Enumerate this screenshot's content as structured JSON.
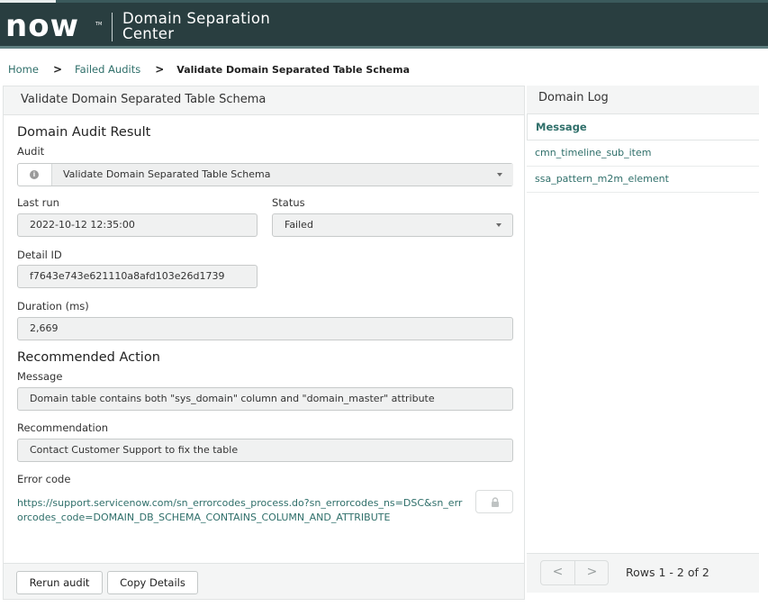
{
  "header": {
    "logo_text": "now",
    "logo_tm": "TM",
    "app_title_line1": "Domain Separation",
    "app_title_line2": "Center"
  },
  "breadcrumb": {
    "home": "Home",
    "failed_audits": "Failed Audits",
    "current": "Validate Domain Separated Table Schema",
    "separator": ">"
  },
  "panel": {
    "title": "Validate Domain Separated Table Schema"
  },
  "audit_result": {
    "section_title": "Domain Audit Result",
    "audit_label": "Audit",
    "audit_value": "Validate Domain Separated Table Schema",
    "last_run_label": "Last run",
    "last_run_value": "2022-10-12 12:35:00",
    "status_label": "Status",
    "status_value": "Failed",
    "detail_id_label": "Detail ID",
    "detail_id_value": "f7643e743e621110a8afd103e26d1739",
    "duration_label": "Duration (ms)",
    "duration_value": "2,669"
  },
  "recommended_action": {
    "section_title": "Recommended Action",
    "message_label": "Message",
    "message_value": "Domain table contains both \"sys_domain\" column and \"domain_master\" attribute",
    "recommendation_label": "Recommendation",
    "recommendation_value": "Contact Customer Support to fix the table",
    "error_code_label": "Error code",
    "error_code_link": "https://support.servicenow.com/sn_errorcodes_process.do?sn_errorcodes_ns=DSC&sn_errorcodes_code=DOMAIN_DB_SCHEMA_CONTAINS_COLUMN_AND_ATTRIBUTE"
  },
  "buttons": {
    "rerun": "Rerun audit",
    "copy": "Copy Details"
  },
  "domain_log": {
    "title": "Domain Log",
    "column_header": "Message",
    "rows": [
      "cmn_timeline_sub_item",
      "ssa_pattern_m2m_element"
    ],
    "pager_prev": "<",
    "pager_next": ">",
    "rows_label": "Rows 1 - 2 of 2"
  },
  "icons": {
    "info": "info-icon",
    "lock": "lock-icon",
    "caret": "chevron-down-icon"
  },
  "colors": {
    "header_bg": "#293e40",
    "link": "#2f6f6a"
  }
}
